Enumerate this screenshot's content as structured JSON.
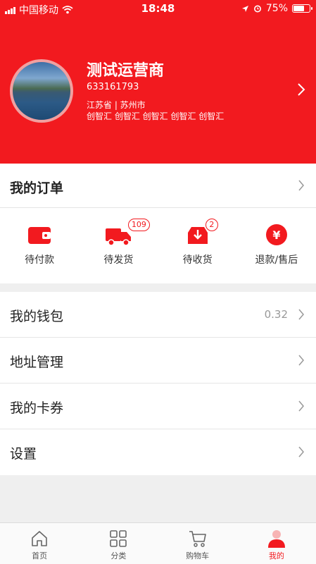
{
  "status_bar": {
    "carrier": "中国移动",
    "time": "18:48",
    "battery": "75%",
    "battery_level": 0.75
  },
  "profile": {
    "name": "测试运营商",
    "id": "633161793",
    "location": "江苏省 | 苏州市",
    "tags": "创智汇 创智汇 创智汇 创智汇 创智汇"
  },
  "orders": {
    "title": "我的订单",
    "items": [
      {
        "label": "待付款",
        "icon": "wallet-icon",
        "badge": ""
      },
      {
        "label": "待发货",
        "icon": "truck-icon",
        "badge": "109"
      },
      {
        "label": "待收货",
        "icon": "inbox-icon",
        "badge": "2"
      },
      {
        "label": "退款/售后",
        "icon": "yuan-icon",
        "badge": ""
      }
    ]
  },
  "menu": [
    {
      "label": "我的钱包",
      "value": "0.32"
    },
    {
      "label": "地址管理",
      "value": ""
    },
    {
      "label": "我的卡券",
      "value": ""
    },
    {
      "label": "设置",
      "value": ""
    }
  ],
  "tabbar": {
    "tabs": [
      {
        "label": "首页",
        "icon": "home-icon"
      },
      {
        "label": "分类",
        "icon": "grid-icon"
      },
      {
        "label": "购物车",
        "icon": "cart-icon"
      },
      {
        "label": "我的",
        "icon": "user-icon",
        "active": true
      }
    ]
  },
  "colors": {
    "brand": "#f21a1f",
    "background": "#efefef",
    "muted_text": "#999999"
  }
}
